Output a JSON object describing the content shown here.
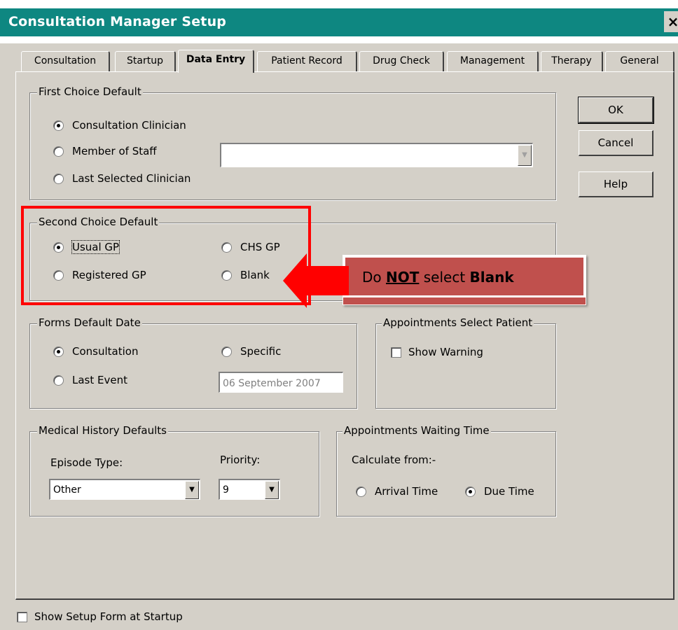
{
  "window": {
    "title": "Consultation Manager Setup",
    "close_label": "×"
  },
  "tabs": [
    {
      "label": "Consultation"
    },
    {
      "label": "Startup"
    },
    {
      "label": "Data Entry"
    },
    {
      "label": "Patient Record"
    },
    {
      "label": "Drug Check"
    },
    {
      "label": "Management"
    },
    {
      "label": "Therapy"
    },
    {
      "label": "General"
    }
  ],
  "active_tab": "Data Entry",
  "buttons": {
    "ok": "OK",
    "cancel": "Cancel",
    "help": "Help"
  },
  "first_choice": {
    "legend": "First Choice Default",
    "options": [
      "Consultation Clinician",
      "Member of Staff",
      "Last Selected Clinician"
    ],
    "selected": "Consultation Clinician",
    "staff_value": ""
  },
  "second_choice": {
    "legend": "Second Choice Default",
    "options": [
      "Usual GP",
      "CHS GP",
      "Registered GP",
      "Blank"
    ],
    "selected": "Usual GP"
  },
  "forms_default_date": {
    "legend": "Forms Default Date",
    "options": [
      "Consultation",
      "Specific",
      "Last Event"
    ],
    "selected": "Consultation",
    "specific_date": "06 September 2007"
  },
  "appointments_select_patient": {
    "legend": "Appointments Select Patient",
    "show_warning": "Show Warning",
    "checked": false
  },
  "medical_history": {
    "legend": "Medical History Defaults",
    "episode_label": "Episode Type:",
    "episode_value": "Other",
    "priority_label": "Priority:",
    "priority_value": "9"
  },
  "appointments_waiting": {
    "legend": "Appointments Waiting Time",
    "calc_label": "Calculate from:-",
    "options": [
      "Arrival Time",
      "Due Time"
    ],
    "selected": "Due Time"
  },
  "footer": {
    "show_setup": "Show Setup Form at Startup",
    "checked": false
  },
  "annotation": {
    "prefix": "Do ",
    "emph": "NOT",
    "middle": " select ",
    "target": "Blank"
  },
  "colors": {
    "titlebar": "#0e8781",
    "annotation_box": "#c0504d",
    "highlight": "#ff0000"
  }
}
